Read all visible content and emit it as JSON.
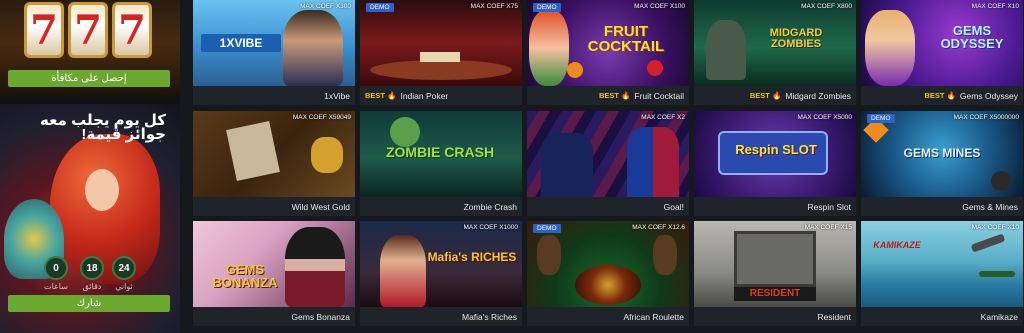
{
  "promo_top": {
    "reels": [
      "7",
      "7",
      "7"
    ],
    "button_label": "إحصل على مكافأة"
  },
  "promo_daily": {
    "title": "كل يوم يجلب معه جوائز قيمة!",
    "counters": [
      {
        "value": "24",
        "label": "ثواني"
      },
      {
        "value": "18",
        "label": "دقائق"
      },
      {
        "value": "0",
        "label": "ساعات"
      }
    ],
    "button_label": "شارك"
  },
  "colors": {
    "accent_green": "#6aa82e",
    "demo_badge": "#2b63c9",
    "best_text": "#f0c419"
  },
  "games": [
    {
      "name": "1xVibe",
      "coef": "MAX COEF X300",
      "demo": "",
      "best": "",
      "art_title": "1XVIBE"
    },
    {
      "name": "Indian Poker",
      "coef": "MAX COEF X75",
      "demo": "DEMO",
      "best": "BEST",
      "art_title": ""
    },
    {
      "name": "Fruit Cocktail",
      "coef": "MAX COEF X100",
      "demo": "DEMO",
      "best": "BEST",
      "art_title": "FRUIT COCKTAIL"
    },
    {
      "name": "Midgard Zombies",
      "coef": "MAX COEF X800",
      "demo": "",
      "best": "BEST",
      "art_title": "MIDGARD ZOMBIES"
    },
    {
      "name": "Gems Odyssey",
      "coef": "MAX COEF X10",
      "demo": "",
      "best": "BEST",
      "art_title": "GEMS ODYSSEY"
    },
    {
      "name": "Wild West Gold",
      "coef": "MAX COEF X59049",
      "demo": "",
      "best": "",
      "art_title": ""
    },
    {
      "name": "Zombie Crash",
      "coef": "",
      "demo": "",
      "best": "",
      "art_title": "ZOMBIE CRASH"
    },
    {
      "name": "Goal!",
      "coef": "MAX COEF X2",
      "demo": "",
      "best": "",
      "art_title": ""
    },
    {
      "name": "Respin Slot",
      "coef": "MAX COEF X5000",
      "demo": "",
      "best": "",
      "art_title": "Respin SLOT"
    },
    {
      "name": "Gems & Mines",
      "coef": "MAX COEF X5000000",
      "demo": "DEMO",
      "best": "",
      "art_title": "GEMS MINES"
    },
    {
      "name": "Gems Bonanza",
      "coef": "",
      "demo": "",
      "best": "",
      "art_title": "GEMS BONANZA"
    },
    {
      "name": "Mafia's Riches",
      "coef": "MAX COEF X1000",
      "demo": "",
      "best": "",
      "art_title": "Mafia's RICHES"
    },
    {
      "name": "African Roulette",
      "coef": "MAX COEF X12.6",
      "demo": "DEMO",
      "best": "",
      "art_title": ""
    },
    {
      "name": "Resident",
      "coef": "MAX COEF X15",
      "demo": "",
      "best": "",
      "art_title": "RESIDENT"
    },
    {
      "name": "Kamikaze",
      "coef": "MAX COEF X10",
      "demo": "",
      "best": "",
      "art_title": "KAMIKAZE"
    }
  ]
}
